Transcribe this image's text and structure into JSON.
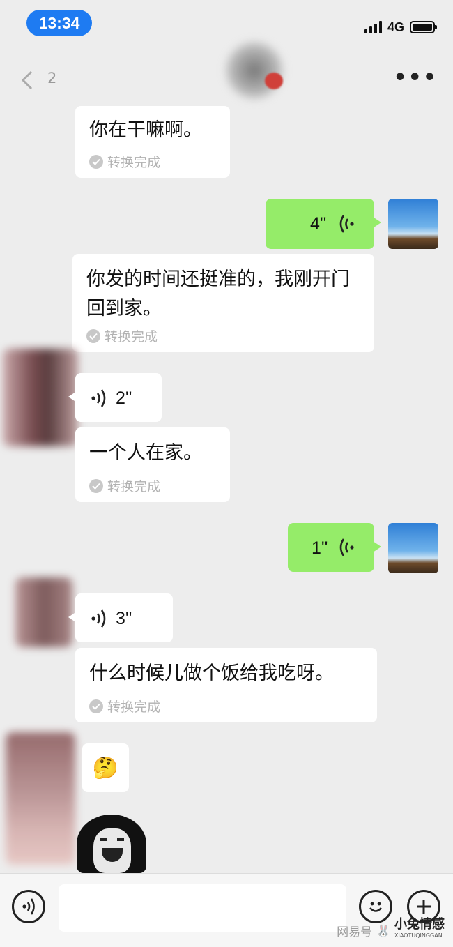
{
  "status": {
    "time": "13:34",
    "network": "4G"
  },
  "nav": {
    "count": "2",
    "more": "•••"
  },
  "messages": {
    "m1": {
      "text": "你在干嘛啊。",
      "conv": "转换完成"
    },
    "m2": {
      "duration": "4''"
    },
    "m3": {
      "text": "你发的时间还挺准的，我刚开门回到家。",
      "conv": "转换完成"
    },
    "m4": {
      "duration": "2''"
    },
    "m5": {
      "text": "一个人在家。",
      "conv": "转换完成"
    },
    "m6": {
      "duration": "1''"
    },
    "m7": {
      "duration": "3''"
    },
    "m8": {
      "text": "什么时候儿做个饭给我吃呀。",
      "conv": "转换完成"
    },
    "m9": {
      "emoji": "🤔"
    }
  },
  "watermark": {
    "left": "网易号",
    "right": "小兔情感",
    "sub": "XIAOTUQINGGAN"
  },
  "icons": [
    "back-chevron-icon",
    "more-icon",
    "voice-wave-icon",
    "check-icon",
    "emoji-icon",
    "plus-icon",
    "voice-toggle-icon"
  ]
}
